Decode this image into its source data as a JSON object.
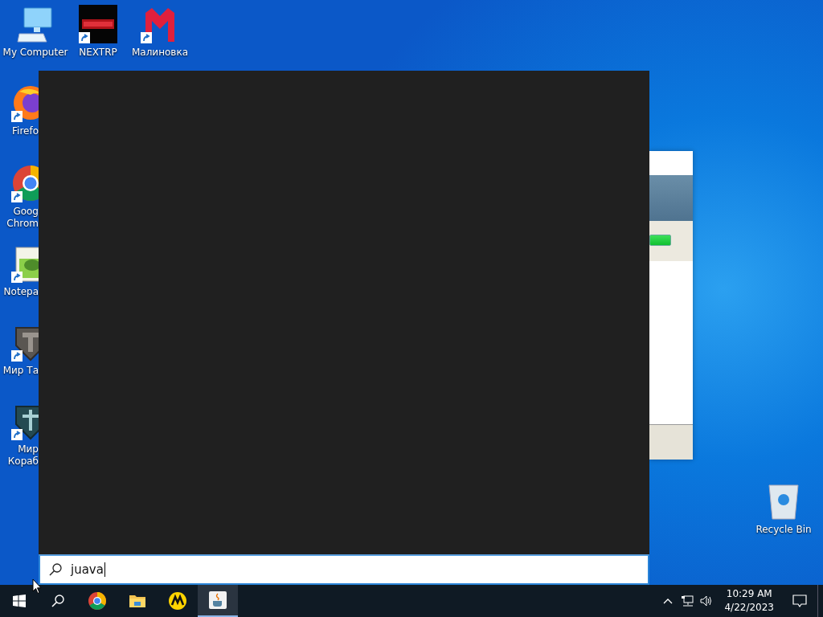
{
  "top_icons": [
    {
      "label": "My Computer",
      "kind": "computer",
      "shortcut": false
    },
    {
      "label": "NEXTRP",
      "kind": "nextrp",
      "shortcut": true
    },
    {
      "label": "Малиновка",
      "kind": "malinovka",
      "shortcut": true
    }
  ],
  "left_icons": [
    {
      "lines": [
        "Firefo"
      ],
      "kind": "firefox"
    },
    {
      "lines": [
        "Goog",
        "Chrom"
      ],
      "kind": "chrome"
    },
    {
      "lines": [
        "Notepa"
      ],
      "kind": "notepad"
    },
    {
      "lines": [
        "Мир Та"
      ],
      "kind": "tanks"
    },
    {
      "lines": [
        "Мир",
        "Кораб"
      ],
      "kind": "ships"
    }
  ],
  "recycle_bin": {
    "label": "Recycle Bin"
  },
  "search_panel": {
    "query": "juava"
  },
  "taskbar": {
    "apps": [
      {
        "kind": "chrome",
        "selected": false
      },
      {
        "kind": "explorer",
        "selected": false
      },
      {
        "kind": "yandex",
        "selected": false
      },
      {
        "kind": "java",
        "selected": true
      }
    ],
    "time": "10:29 AM",
    "date": "4/22/2023"
  }
}
